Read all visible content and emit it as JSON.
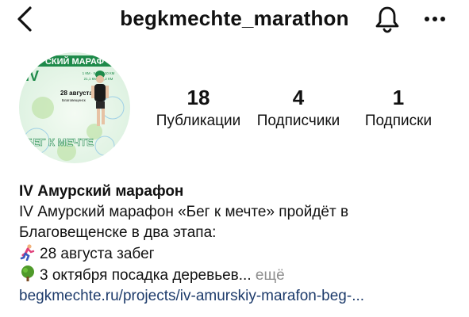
{
  "header": {
    "username": "begkmechte_marathon",
    "back_icon": "chevron-left-icon",
    "bell_icon": "bell-icon",
    "more_icon": "more-horizontal-icon"
  },
  "avatar": {
    "title": "СКИЙ МАРАФ",
    "roman": "IV",
    "distances_row1": "1 КМ · 5 КМ · 10 КМ",
    "distances_row2": "21,1 КМ · 42,2 КМ",
    "date": "28 августа",
    "city": "Благовещенск",
    "slogan": "БЕГ К МЕЧТЕ"
  },
  "stats": [
    {
      "value": "18",
      "label": "Публикации"
    },
    {
      "value": "4",
      "label": "Подписчики"
    },
    {
      "value": "1",
      "label": "Подписки"
    }
  ],
  "bio": {
    "name": "IV Амурский марафон",
    "line1": "IV Амурский марафон «Бег к мечте» пройдёт в",
    "line2": "Благовещенске в два этапа:",
    "line3": "28 августа забег",
    "line4": "3 октября посадка деревьев...",
    "more": "ещё",
    "link": "begkmechte.ru/projects/iv-amurskiy-marafon-beg-..."
  },
  "colors": {
    "background": "#ffffff",
    "text": "#111111",
    "muted": "#8e8e8e",
    "link": "#1d3b6b",
    "avatar_green": "#1e8a4a"
  }
}
